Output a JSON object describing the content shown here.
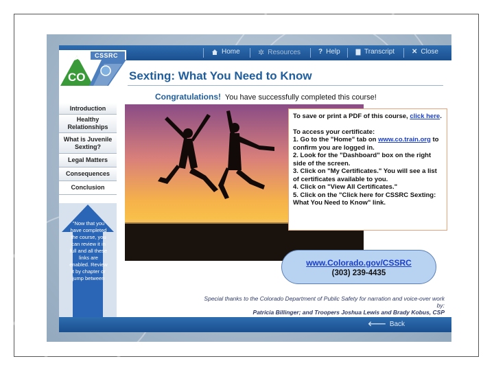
{
  "topbar": {
    "home_label": "Home",
    "resources_label": "Resources",
    "help_label": "Help",
    "transcript_label": "Transcript",
    "close_label": "Close"
  },
  "logo": {
    "org": "CSSRC",
    "state": "CO"
  },
  "page": {
    "title": "Sexting: What You Need to Know",
    "congrats_bold": "Congratulations!",
    "congrats_text": "You have successfully completed this course!"
  },
  "sidebar": {
    "items": [
      {
        "label": "Introduction"
      },
      {
        "label": "Healthy Relationships"
      },
      {
        "label": "What is Juvenile Sexting?"
      },
      {
        "label": "Legal Matters"
      },
      {
        "label": "Consequences"
      },
      {
        "label": "Conclusion"
      }
    ],
    "note": "\"Now that you have completed the course, you can review it in full and all these links are enabled. Review it by chapter or jump between"
  },
  "info": {
    "save_text": "To save or print a PDF of this course,",
    "save_link": "click here",
    "save_end": ".",
    "access_heading": "To access your certificate:",
    "step1_a": "1.  Go to the \"Home\" tab on",
    "step1_link": "www.co.train.org",
    "step1_b": "to confirm you are logged in.",
    "step2": "2.  Look for the \"Dashboard\" box on the right side of the screen.",
    "step3": "3.  Click on \"My Certificates.\" You will see a list of certificates available to you.",
    "step4": "4.  Click on \"View All Certificates.\"",
    "step5": "5.  Click on the \"Click here for CSSRC Sexting: What You Need to Know\" link."
  },
  "contact": {
    "url": "www.Colorado.gov/CSSRC",
    "phone": "(303) 239-4435"
  },
  "thanks": {
    "line1": "Special thanks to the Colorado Department of Public Safety for narration and voice-over work by:",
    "names": "Patricia Billinger; and Troopers Joshua Lewis and Brady Kobus, CSP"
  },
  "bottombar": {
    "back_label": "Back"
  },
  "colors": {
    "accent": "#1f5d9c",
    "bar": "#1a4f8f",
    "logo_green": "#3a9a3a",
    "link": "#1a3ec9"
  }
}
